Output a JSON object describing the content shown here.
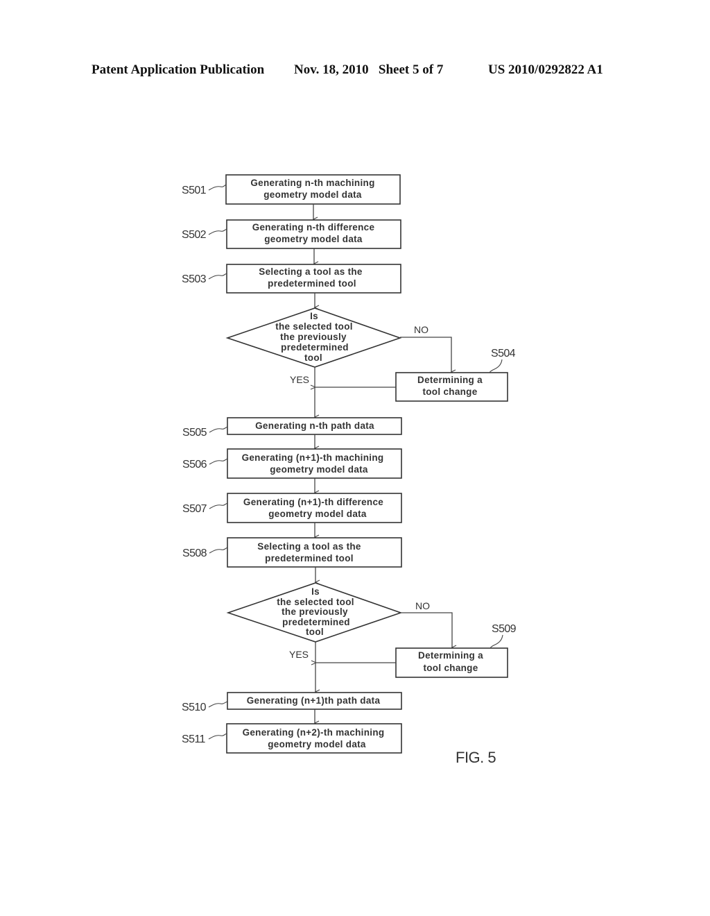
{
  "header": {
    "publication": "Patent Application Publication",
    "date_sheet": "Nov. 18, 2010   Sheet 5 of 7",
    "number": "US 2010/0292822 A1"
  },
  "figure_label": "FIG. 5",
  "steps": {
    "s501": {
      "id": "S501",
      "lines": [
        "Generating n-th machining",
        "geometry model data"
      ]
    },
    "s502": {
      "id": "S502",
      "lines": [
        "Generating n-th difference",
        "geometry model data"
      ]
    },
    "s503": {
      "id": "S503",
      "lines": [
        "Selecting a tool as the",
        "predetermined tool"
      ]
    },
    "d1": {
      "lines": [
        "Is",
        "the selected tool",
        "the previously",
        "predetermined",
        "tool"
      ],
      "no": "NO",
      "yes": "YES"
    },
    "s504": {
      "id": "S504",
      "lines": [
        "Determining a",
        "tool change"
      ]
    },
    "s505": {
      "id": "S505",
      "lines": [
        "Generating n-th path data"
      ]
    },
    "s506": {
      "id": "S506",
      "lines": [
        "Generating (n+1)-th machining",
        "geometry model data"
      ]
    },
    "s507": {
      "id": "S507",
      "lines": [
        "Generating (n+1)-th difference",
        "geometry model data"
      ]
    },
    "s508": {
      "id": "S508",
      "lines": [
        "Selecting a tool as the",
        "predetermined tool"
      ]
    },
    "d2": {
      "lines": [
        "Is",
        "the selected tool",
        "the previously",
        "predetermined",
        "tool"
      ],
      "no": "NO",
      "yes": "YES"
    },
    "s509": {
      "id": "S509",
      "lines": [
        "Determining a",
        "tool change"
      ]
    },
    "s510": {
      "id": "S510",
      "lines": [
        "Generating (n+1)th path data"
      ]
    },
    "s511": {
      "id": "S511",
      "lines": [
        "Generating (n+2)-th machining",
        "geometry model data"
      ]
    }
  }
}
